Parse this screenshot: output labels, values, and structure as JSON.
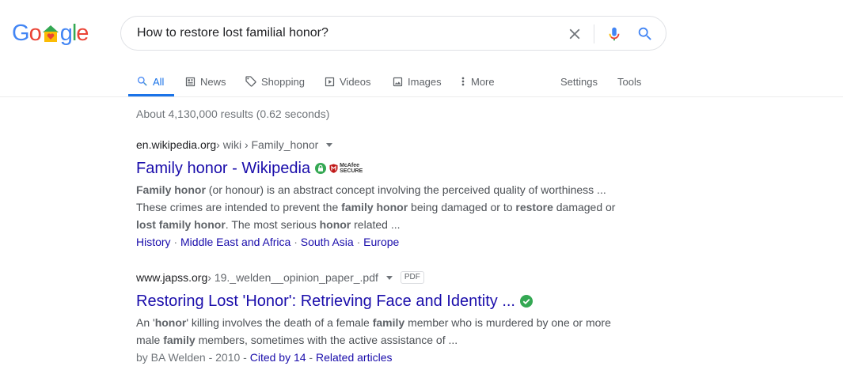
{
  "logo": {
    "parts": [
      "G",
      "o",
      "",
      "g",
      "l",
      "e"
    ]
  },
  "search": {
    "query": "How to restore lost familial honor?"
  },
  "icons": {
    "clear": "close-icon",
    "mic": "microphone-icon",
    "search": "search-icon"
  },
  "tabs": [
    {
      "label": "All",
      "icon": "search-icon"
    },
    {
      "label": "News",
      "icon": "news-icon"
    },
    {
      "label": "Shopping",
      "icon": "tag-icon"
    },
    {
      "label": "Videos",
      "icon": "play-icon"
    },
    {
      "label": "Images",
      "icon": "image-icon"
    },
    {
      "label": "More",
      "icon": "more-vertical-icon"
    }
  ],
  "tools": {
    "settings": "Settings",
    "tools": "Tools"
  },
  "stats": "About 4,130,000 results (0.62 seconds)",
  "results": [
    {
      "domain": "en.wikipedia.org",
      "crumbs": " › wiki › Family_honor",
      "title": "Family honor - Wikipedia",
      "badge_text": [
        "McAfee",
        "SECURE"
      ],
      "snippet": [
        [
          {
            "b": "Family honor"
          },
          {
            "t": " (or honour) is an abstract concept involving the perceived quality of worthiness ..."
          }
        ],
        [
          {
            "t": "These crimes are intended to prevent the "
          },
          {
            "b": "family honor"
          },
          {
            "t": " being damaged or to "
          },
          {
            "b": "restore"
          },
          {
            "t": " damaged or"
          }
        ],
        [
          {
            "b": "lost family honor"
          },
          {
            "t": ". The most serious "
          },
          {
            "b": "honor"
          },
          {
            "t": " related ..."
          }
        ]
      ],
      "sitelinks": [
        "History",
        "Middle East and Africa",
        "South Asia",
        "Europe"
      ]
    },
    {
      "domain": "www.japss.org",
      "crumbs": " › 19._welden__opinion_paper_.pdf",
      "file_type": "PDF",
      "title": "Restoring Lost 'Honor': Retrieving Face and Identity ...",
      "snippet": [
        [
          {
            "t": "An '"
          },
          {
            "b": "honor"
          },
          {
            "t": "' killing involves the death of a female "
          },
          {
            "b": "family"
          },
          {
            "t": " member who is murdered by one or more"
          }
        ],
        [
          {
            "t": "male "
          },
          {
            "b": "family"
          },
          {
            "t": " members, sometimes with the active assistance of ..."
          }
        ]
      ],
      "meta_prefix": "by BA Welden - 2010 - ",
      "cited_by": "Cited by 14",
      "related": "Related articles"
    }
  ],
  "colors": {
    "link": "#1a0dab",
    "accent": "#1a73e8",
    "secure_green": "#34a853"
  }
}
